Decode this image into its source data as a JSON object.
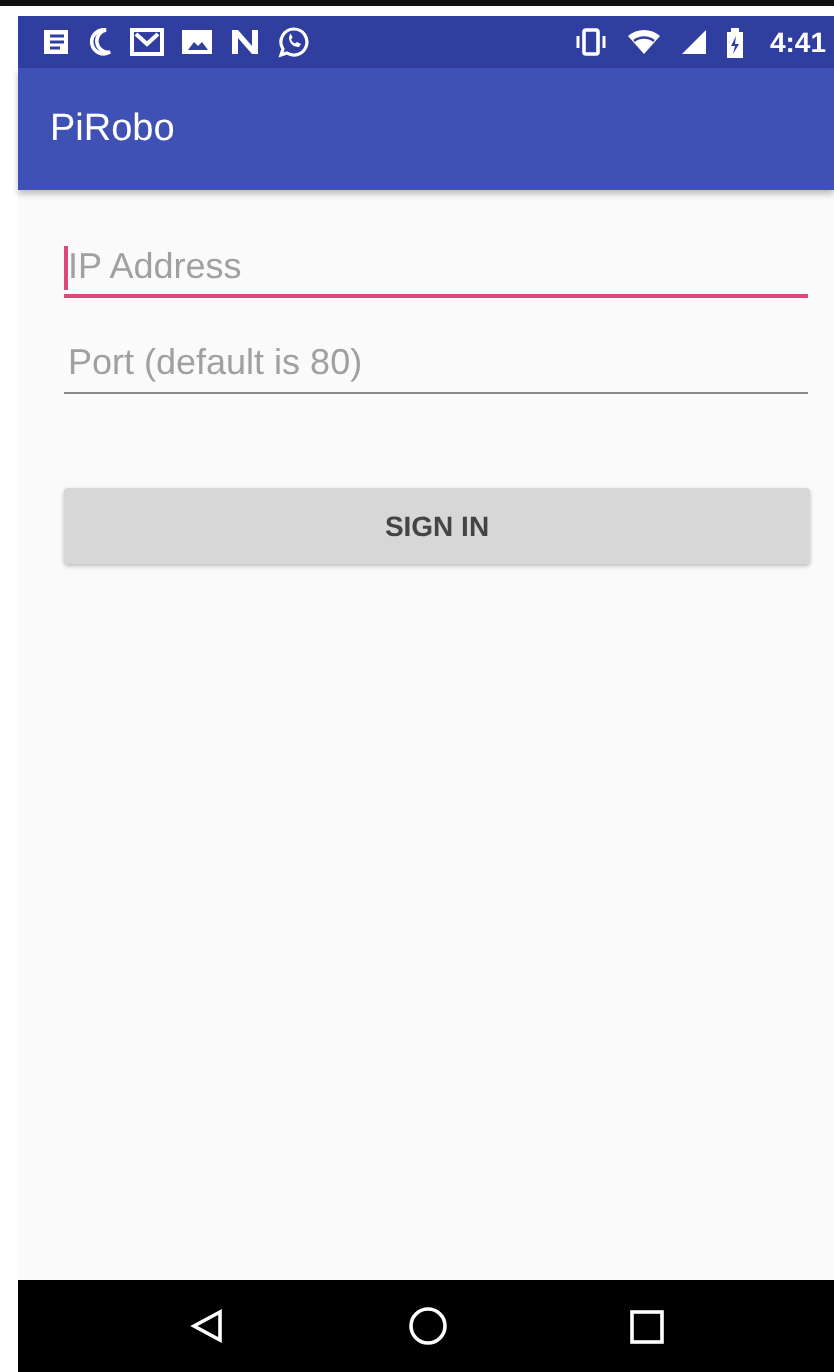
{
  "status_bar": {
    "time": "4:41"
  },
  "app_bar": {
    "title": "PiRobo"
  },
  "fields": [
    {
      "placeholder": "IP Address",
      "focused": true
    },
    {
      "placeholder": "Port (default is 80)",
      "focused": false
    }
  ],
  "button": {
    "label": "SIGN IN"
  }
}
